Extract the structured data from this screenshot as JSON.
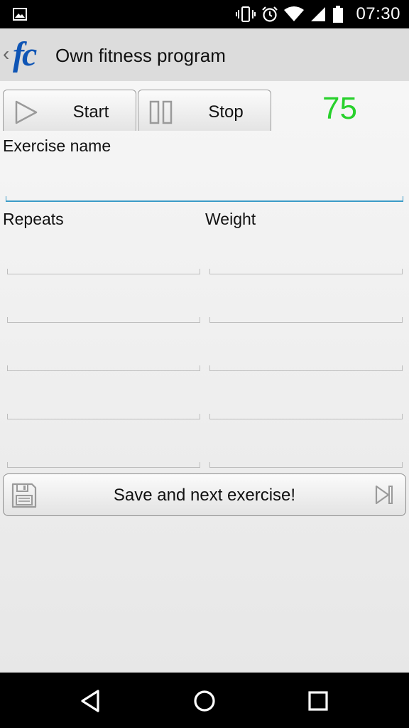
{
  "status_bar": {
    "time": "07:30",
    "icons": [
      "image-notification-icon",
      "vibrate-icon",
      "alarm-icon",
      "wifi-icon",
      "signal-icon",
      "battery-icon"
    ]
  },
  "action_bar": {
    "title": "Own fitness program",
    "logo_text": "fc",
    "logo_color": "#0f55b5"
  },
  "controls": {
    "start_label": "Start",
    "stop_label": "Stop",
    "timer_value": "75",
    "timer_color": "#28d12c"
  },
  "form": {
    "exercise_name_label": "Exercise name",
    "exercise_name_value": "",
    "repeats_label": "Repeats",
    "weight_label": "Weight",
    "sets": [
      {
        "repeats": "",
        "weight": ""
      },
      {
        "repeats": "",
        "weight": ""
      },
      {
        "repeats": "",
        "weight": ""
      },
      {
        "repeats": "",
        "weight": ""
      },
      {
        "repeats": "",
        "weight": ""
      }
    ],
    "accent_color": "#3b9bc7"
  },
  "save_button": {
    "label": "Save and next exercise!"
  },
  "nav_bar": {
    "buttons": [
      "back-icon",
      "home-icon",
      "recents-icon"
    ]
  }
}
